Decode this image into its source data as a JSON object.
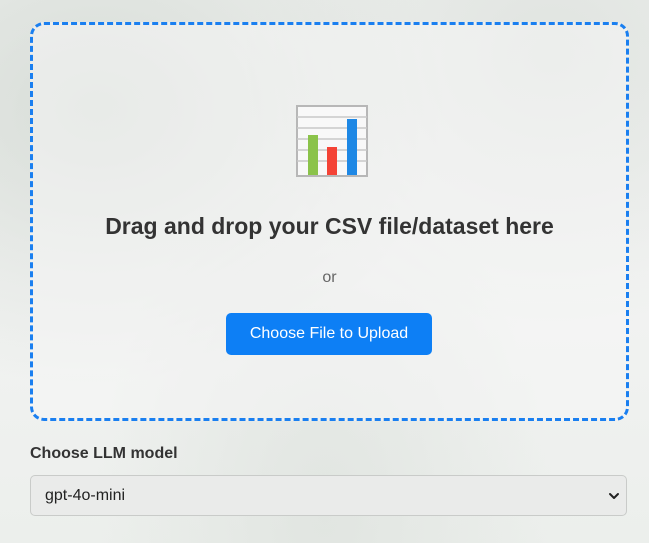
{
  "upload": {
    "icon": "bar-chart-icon",
    "title": "Drag and drop your CSV file/dataset here",
    "or_text": "or",
    "button_label": "Choose File to Upload"
  },
  "model": {
    "label": "Choose LLM model",
    "selected": "gpt-4o-mini"
  },
  "colors": {
    "accent": "#0d7ff5",
    "dashed_border": "#1a7ff0",
    "bar_green": "#8bc34a",
    "bar_red": "#f44336",
    "bar_blue": "#1e88e5"
  }
}
